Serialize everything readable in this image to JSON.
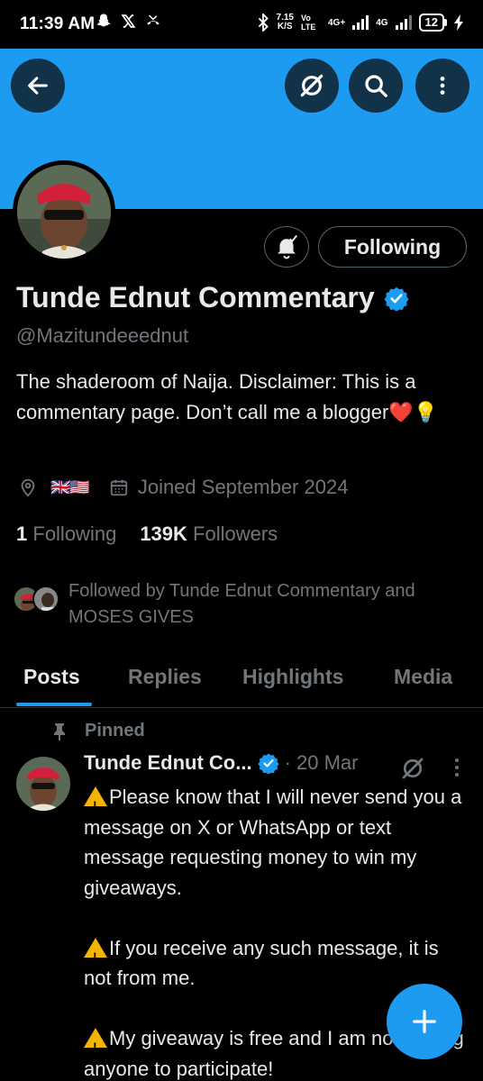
{
  "status_bar": {
    "time": "11:39 AM",
    "icons": [
      "snapchat-icon",
      "x-icon",
      "missed-call-icon"
    ],
    "speed_value": "7.15",
    "speed_unit": "K/S",
    "network_1": "Vo LTE",
    "network_2": "4G+",
    "network_3": "4G",
    "battery": "12"
  },
  "colors": {
    "accent": "#1d9bf0",
    "background": "#000000",
    "text": "#e7e9ea",
    "muted": "#71767b",
    "border": "#2f3336"
  },
  "profile": {
    "name": "Tunde Ednut Commentary",
    "verified": true,
    "handle": "@Mazitundeeednut",
    "bio": "The shaderoom of Naija. Disclaimer: This is a commentary page. Don’t call me a blogger❤️💡",
    "location_flags": "🇬🇧🇺🇸",
    "joined": "Joined September 2024",
    "following_count": "1",
    "following_label": "Following",
    "followers_count": "139K",
    "followers_label": "Followers",
    "followed_by": "Followed by Tunde Ednut Commentary and MOSES GIVES"
  },
  "actions": {
    "follow_state": "Following"
  },
  "tabs": [
    {
      "label": "Posts",
      "active": true
    },
    {
      "label": "Replies",
      "active": false
    },
    {
      "label": "Highlights",
      "active": false
    },
    {
      "label": "Media",
      "active": false
    }
  ],
  "pinned_post": {
    "pinned_label": "Pinned",
    "author": "Tunde Ednut Co...",
    "date": "· 20 Mar",
    "paragraphs": [
      "Please know that I will never send you a message on X or WhatsApp or text message requesting money to win my giveaways.",
      "If you receive any such message, it is not from me.",
      "My giveaway is free and I am not forcing anyone to participate!"
    ]
  }
}
